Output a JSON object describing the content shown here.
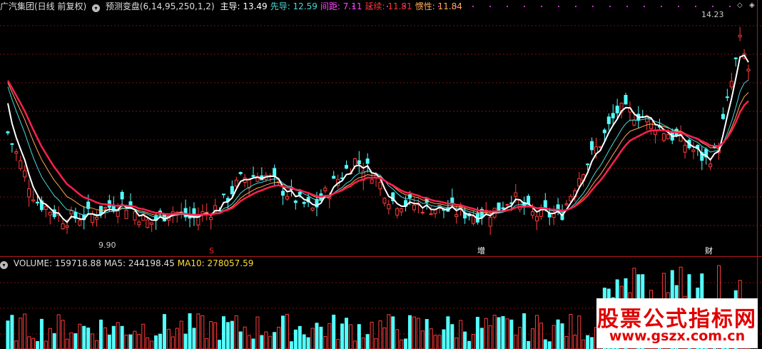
{
  "header": {
    "stock_title": "广汽集团(日线 前复权)",
    "indicator_name": "预测变盘(6,14,95,250,1,2)",
    "values": [
      {
        "label": "主导:",
        "value": "13.49",
        "color": "#ffffff"
      },
      {
        "label": "先导:",
        "value": "12.59",
        "color": "#44dddd"
      },
      {
        "label": "间距:",
        "value": "7.11",
        "color": "#ff44ff"
      },
      {
        "label": "延续:",
        "value": "11.81",
        "color": "#ff3333"
      },
      {
        "label": "惯性:",
        "value": "11.84",
        "color": "#ffaa55"
      }
    ]
  },
  "price_panel": {
    "high_label": "14.23",
    "low_label": "9.90",
    "event_marks": [
      {
        "text": "S",
        "color": "#ff2222"
      },
      {
        "text": "增",
        "color": "#ffffff"
      },
      {
        "text": "财",
        "color": "#ffffff"
      }
    ]
  },
  "volume_panel": {
    "labels": [
      {
        "label": "VOLUME:",
        "value": "159718.88",
        "color": "#dddddd"
      },
      {
        "label": "MA5:",
        "value": "244198.45",
        "color": "#dddddd"
      },
      {
        "label": "MA10:",
        "value": "278057.59",
        "color": "#ffdd33"
      }
    ]
  },
  "watermark": {
    "title": "股票公式指标网",
    "url": "www.gszx.com.cn"
  },
  "colors": {
    "background": "#000000",
    "grid": "#7a1010",
    "up_candle": "#ff3b3b",
    "down_candle": "#54ffff",
    "ma_red": "#ff1f4f",
    "ma_cyan": "#44dddd",
    "ma_orange": "#ffaa55",
    "ma_white": "#ffffff",
    "accent": "#e00000"
  },
  "chart_data": {
    "type": "candlestick",
    "price_high": 14.23,
    "price_low": 9.9,
    "price_range": [
      9.4,
      14.8
    ],
    "key_points": [
      {
        "i": 0,
        "c": 12.1
      },
      {
        "i": 20,
        "c": 10.6
      },
      {
        "i": 40,
        "c": 10.2
      },
      {
        "i": 60,
        "c": 10.3
      },
      {
        "i": 80,
        "c": 10.6
      },
      {
        "i": 100,
        "c": 10.1
      },
      {
        "i": 115,
        "c": 10.4
      },
      {
        "i": 130,
        "c": 10.2
      },
      {
        "i": 150,
        "c": 10.5
      },
      {
        "i": 165,
        "c": 11.1
      },
      {
        "i": 180,
        "c": 11.2
      },
      {
        "i": 200,
        "c": 10.7
      },
      {
        "i": 215,
        "c": 10.4
      },
      {
        "i": 230,
        "c": 11.0
      },
      {
        "i": 245,
        "c": 11.5
      },
      {
        "i": 258,
        "c": 11.2
      },
      {
        "i": 270,
        "c": 10.6
      },
      {
        "i": 290,
        "c": 10.5
      },
      {
        "i": 310,
        "c": 10.4
      },
      {
        "i": 330,
        "c": 10.3
      },
      {
        "i": 345,
        "c": 10.4
      },
      {
        "i": 355,
        "c": 10.7
      },
      {
        "i": 370,
        "c": 10.3
      },
      {
        "i": 390,
        "c": 10.3
      },
      {
        "i": 405,
        "c": 11.3
      },
      {
        "i": 418,
        "c": 11.9
      },
      {
        "i": 430,
        "c": 12.6
      },
      {
        "i": 445,
        "c": 12.5
      },
      {
        "i": 460,
        "c": 12.2
      },
      {
        "i": 470,
        "c": 12.0
      },
      {
        "i": 480,
        "c": 11.8
      },
      {
        "i": 492,
        "c": 11.5
      },
      {
        "i": 500,
        "c": 11.7
      },
      {
        "i": 510,
        "c": 13.2
      },
      {
        "i": 516,
        "c": 14.1
      },
      {
        "i": 522,
        "c": 13.5
      }
    ]
  }
}
